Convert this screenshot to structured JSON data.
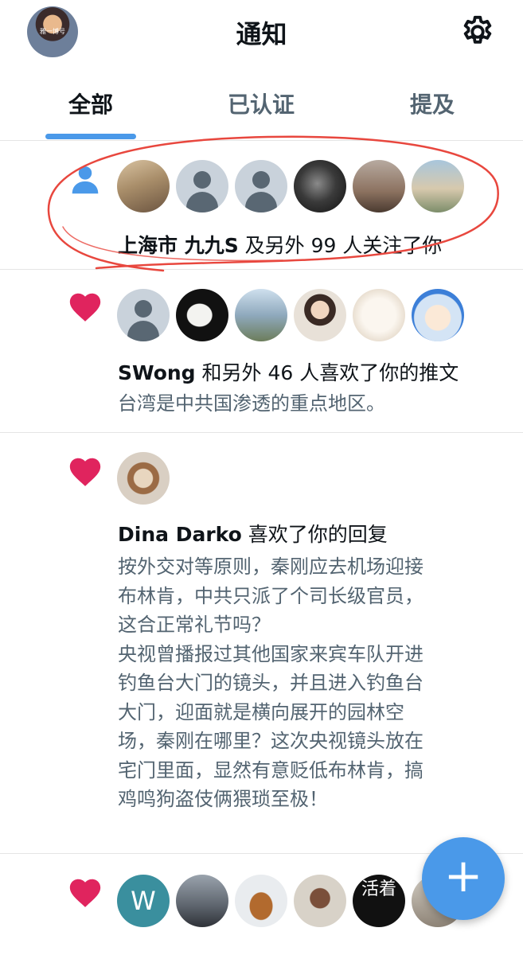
{
  "header": {
    "title": "通知",
    "avatar_tag": "雅一博号"
  },
  "tabs": [
    {
      "label": "全部",
      "selected": true
    },
    {
      "label": "已认证",
      "selected": false
    },
    {
      "label": "提及",
      "selected": false
    }
  ],
  "notifications": [
    {
      "type": "follow",
      "icon": "person-icon",
      "name": "上海市 九九S",
      "text": " 及另外 99 人关注了你"
    },
    {
      "type": "like",
      "icon": "heart-icon",
      "name": "SWong",
      "text": " 和另外 46 人喜欢了你的推文",
      "tweet": "台湾是中共国渗透的重点地区。"
    },
    {
      "type": "like",
      "icon": "heart-icon",
      "name": "Dina Darko",
      "text": " 喜欢了你的回复",
      "tweet": "按外交对等原则，秦刚应去机场迎接\n布林肯，中共只派了个司长级官员，\n这合正常礼节吗？\n央视曾播报过其他国家来宾车队开进\n钓鱼台大门的镜头，并且进入钓鱼台\n大门，迎面就是横向展开的园林空\n场，秦刚在哪里？这次央视镜头放在\n宅门里面，显然有意贬低布林肯，搞\n鸡鸣狗盗伎俩猥琐至极！"
    },
    {
      "type": "like",
      "icon": "heart-icon",
      "avatar_letter": "W",
      "avatar_text": "活着"
    }
  ],
  "fab": {
    "label": "+"
  },
  "colors": {
    "accent": "#4a99e9",
    "heart": "#e0245e",
    "annotation": "#e8473e"
  }
}
